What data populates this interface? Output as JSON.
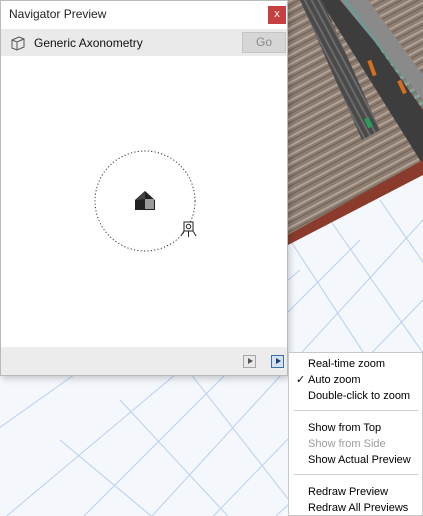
{
  "palette": {
    "title": "Navigator Preview",
    "close_glyph": "x",
    "view_name": "Generic Axonometry",
    "go_label": "Go",
    "icons": {
      "view": "axonometry-cube-icon",
      "model": "house-model-icon",
      "camera": "camera-icon",
      "prev": "play-left-icon",
      "menu": "play-menu-icon"
    }
  },
  "menu": {
    "items": [
      {
        "label": "Real-time zoom",
        "checked": false,
        "enabled": true
      },
      {
        "label": "Auto zoom",
        "checked": true,
        "enabled": true
      },
      {
        "label": "Double-click to zoom",
        "checked": false,
        "enabled": true
      },
      {
        "label": "Show from Top",
        "checked": false,
        "enabled": true
      },
      {
        "label": "Show from Side",
        "checked": false,
        "enabled": false
      },
      {
        "label": "Show Actual Preview",
        "checked": false,
        "enabled": true
      },
      {
        "label": "Redraw Preview",
        "checked": false,
        "enabled": true
      },
      {
        "label": "Redraw All Previews",
        "checked": false,
        "enabled": true
      }
    ],
    "check_glyph": "✓"
  },
  "colors": {
    "close_button": "#c6403f",
    "accent": "#3b6fae",
    "grid_line": "#a9c6ee"
  }
}
